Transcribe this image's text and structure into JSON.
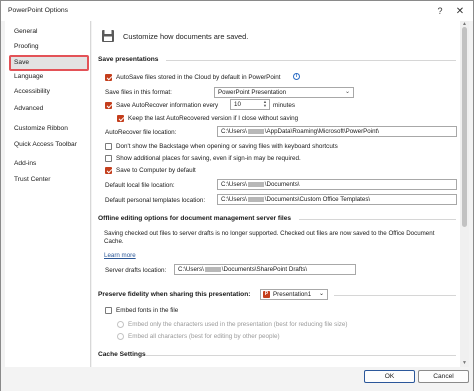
{
  "window": {
    "title": "PowerPoint Options",
    "help_glyph": "?",
    "close_glyph": "✕"
  },
  "sidebar": {
    "items": [
      {
        "label": "General"
      },
      {
        "label": "Proofing"
      },
      {
        "label": "Save"
      },
      {
        "label": "Language"
      },
      {
        "label": "Accessibility"
      },
      {
        "label": "Advanced"
      },
      {
        "label": "Customize Ribbon"
      },
      {
        "label": "Quick Access Toolbar"
      },
      {
        "label": "Add-ins"
      },
      {
        "label": "Trust Center"
      }
    ],
    "active": "Save"
  },
  "header": {
    "text": "Customize how documents are saved.",
    "icon": "floppy-disk-icon"
  },
  "save_presentations": {
    "heading": "Save presentations",
    "autosave_label": "AutoSave files stored in the Cloud by default in PowerPoint",
    "format_label": "Save files in this format:",
    "format_value": "PowerPoint Presentation",
    "autorecover_label": "Save AutoRecover information every",
    "autorecover_minutes": "10",
    "minutes_label": "minutes",
    "keep_last_label": "Keep the last AutoRecovered version if I close without saving",
    "autorecover_location_label": "AutoRecover file location:",
    "autorecover_location_a": "C:\\Users\\",
    "autorecover_location_b": "\\AppData\\Roaming\\Microsoft\\PowerPoint\\",
    "backstage_label": "Don't show the Backstage when opening or saving files with keyboard shortcuts",
    "additional_places_label": "Show additional places for saving, even if sign-in may be required.",
    "save_to_computer_label": "Save to Computer by default",
    "default_local_label": "Default local file location:",
    "default_local_a": "C:\\Users\\",
    "default_local_b": "\\Documents\\",
    "default_templates_label": "Default personal templates location:",
    "default_templates_a": "C:\\Users\\",
    "default_templates_b": "\\Documents\\Custom Office Templates\\"
  },
  "offline": {
    "heading": "Offline editing options for document management server files",
    "note": "Saving checked out files to server drafts is no longer supported. Checked out files are now saved to the Office Document Cache.",
    "learn_more": "Learn more",
    "drafts_label": "Server drafts location:",
    "drafts_a": "C:\\Users\\",
    "drafts_b": "\\Documents\\SharePoint Drafts\\"
  },
  "fidelity": {
    "heading": "Preserve fidelity when sharing this presentation:",
    "presentation": "Presentation1",
    "embed_fonts_label": "Embed fonts in the file",
    "embed_only_used": "Embed only the characters used in the presentation (best for reducing file size)",
    "embed_all": "Embed all characters (best for editing by other people)"
  },
  "cache": {
    "heading": "Cache Settings"
  },
  "buttons": {
    "ok": "OK",
    "cancel": "Cancel"
  },
  "colors": {
    "accent": "#c43e1c",
    "highlight": "#e35257",
    "link": "#2b5797"
  }
}
